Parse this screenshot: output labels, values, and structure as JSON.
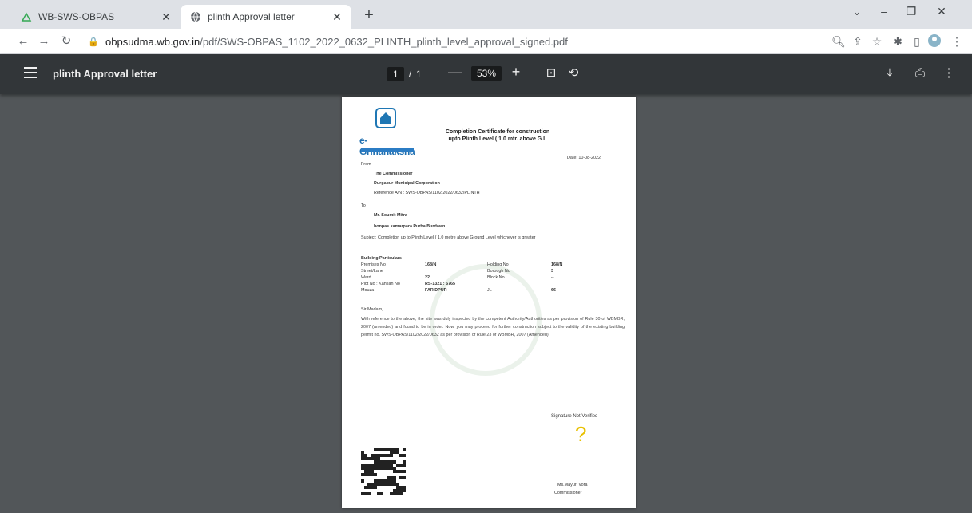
{
  "browser": {
    "tabs": [
      {
        "title": "WB-SWS-OBPAS",
        "active": false
      },
      {
        "title": "plinth Approval letter",
        "active": true
      }
    ],
    "url_host": "obpsudma.wb.gov.in",
    "url_path": "/pdf/SWS-OBPAS_1102_2022_0632_PLINTH_plinth_level_approval_signed.pdf"
  },
  "pdf_viewer": {
    "title": "plinth Approval letter",
    "page_current": "1",
    "page_total": "1",
    "zoom": "53%"
  },
  "document": {
    "brand": "e-Grihanaksha",
    "cert_title_line1": "Completion Certificate for construction",
    "cert_title_line2": "upto Plinth Level ( 1.0 mtr. above G.L",
    "date": "Date: 10-08-2022",
    "from_label": "From",
    "from_name": "The Commissioner",
    "from_org": "Durgapur Municipal Corporation",
    "reference": "Reference A/N : SWS-OBPAS/1102/2022/0632/PLINTH",
    "to_label": "To",
    "to_name": "Mr. Soumit Mitra",
    "to_address": "bonpas kamarpara Purba Burdwan",
    "subject": "Subject: Completion up to Plinth Level ( 1.0 metre above Ground Level whichever is greater",
    "particulars_heading": "Building Particulars",
    "particulars": [
      {
        "label": "Premises No",
        "value": "168/N",
        "label2": "Holding No",
        "value2": "168/N"
      },
      {
        "label": "Street/Lane",
        "value": "",
        "label2": "Borough No",
        "value2": "3"
      },
      {
        "label": "Ward",
        "value": "22",
        "label2": "Block No",
        "value2": "--"
      },
      {
        "label": "Plot No : Kahtian No",
        "value": "RS-1321 : 6765",
        "label2": "",
        "value2": ""
      },
      {
        "label": "Mouza",
        "value": "FARIDPUR",
        "label2": "JL",
        "value2": "66"
      }
    ],
    "salutation": "Sir/Madam,",
    "body": "With reference to the above, the site was duly inspected by the competent Authority/Authorities as per provision of Rule 30 of WBMBR, 2007 (amended) and found to be in order. Now, you may proceed for further construction subject to the validity of the existing building permit no. SWS-OBPAS/1102/2022/0632 as per provision of Rule 23 of WBMBR, 2007 (Amended).",
    "sig_text": "Signature Not Verified",
    "sig_name": "Ms.Mayuri Vora",
    "sig_title": "Commissioner"
  }
}
